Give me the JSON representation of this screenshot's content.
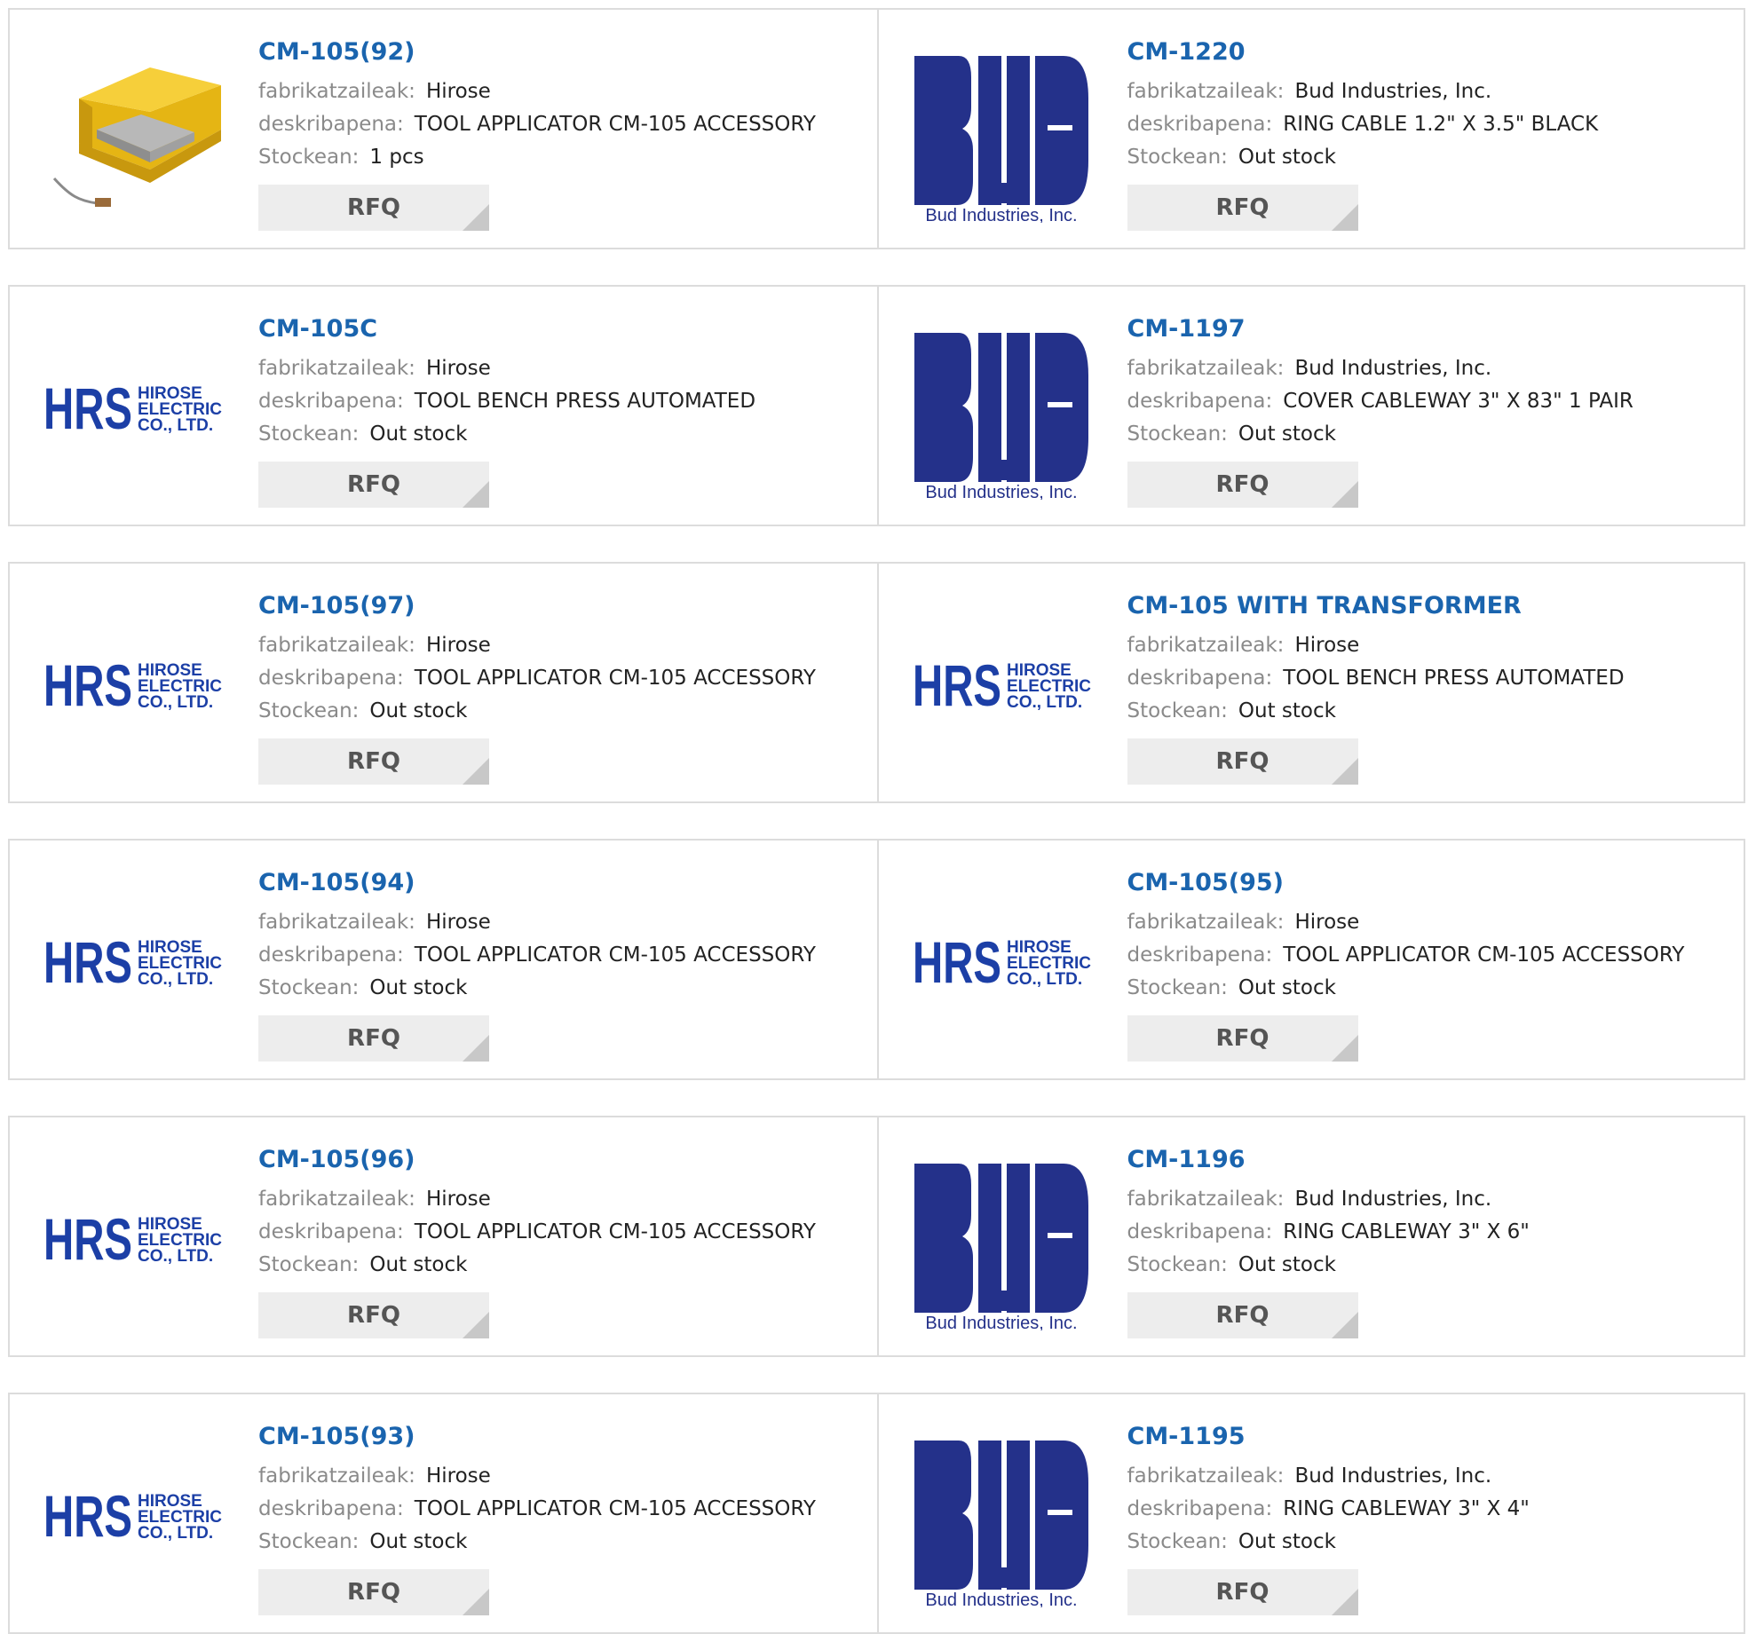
{
  "labels": {
    "manufacturer": "fabrikatzaileak:",
    "description": "deskribapena:",
    "stock": "Stockean:",
    "rfq": "RFQ"
  },
  "logos": {
    "hrs_mark": "HRS",
    "hrs_line1": "HIROSE",
    "hrs_line2": "ELECTRIC",
    "hrs_line3": "CO., LTD.",
    "bud_caption": "Bud Industries, Inc."
  },
  "colors": {
    "part_link": "#1a64ae",
    "label_gray": "#8a8a8a",
    "rfq_bg": "#ededed",
    "hrs_blue": "#1c3fa6",
    "bud_navy": "#24318a",
    "pedal_yellow": "#f2c21b"
  },
  "rows": [
    {
      "left": {
        "part": "CM-105(92)",
        "logo": "product-photo",
        "manufacturer": "Hirose",
        "description": "TOOL APPLICATOR CM-105 ACCESSORY",
        "stock": "1 pcs"
      },
      "right": {
        "part": "CM-1220",
        "logo": "bud-logo",
        "manufacturer": "Bud Industries, Inc.",
        "description": "RING CABLE 1.2\" X 3.5\" BLACK",
        "stock": "Out stock"
      }
    },
    {
      "left": {
        "part": "CM-105C",
        "logo": "hrs-logo",
        "manufacturer": "Hirose",
        "description": "TOOL BENCH PRESS AUTOMATED",
        "stock": "Out stock"
      },
      "right": {
        "part": "CM-1197",
        "logo": "bud-logo",
        "manufacturer": "Bud Industries, Inc.",
        "description": "COVER CABLEWAY 3\" X 83\" 1 PAIR",
        "stock": "Out stock"
      }
    },
    {
      "left": {
        "part": "CM-105(97)",
        "logo": "hrs-logo",
        "manufacturer": "Hirose",
        "description": "TOOL APPLICATOR CM-105 ACCESSORY",
        "stock": "Out stock"
      },
      "right": {
        "part": "CM-105 WITH TRANSFORMER",
        "logo": "hrs-logo",
        "manufacturer": "Hirose",
        "description": "TOOL BENCH PRESS AUTOMATED",
        "stock": "Out stock"
      }
    },
    {
      "left": {
        "part": "CM-105(94)",
        "logo": "hrs-logo",
        "manufacturer": "Hirose",
        "description": "TOOL APPLICATOR CM-105 ACCESSORY",
        "stock": "Out stock"
      },
      "right": {
        "part": "CM-105(95)",
        "logo": "hrs-logo",
        "manufacturer": "Hirose",
        "description": "TOOL APPLICATOR CM-105 ACCESSORY",
        "stock": "Out stock"
      }
    },
    {
      "left": {
        "part": "CM-105(96)",
        "logo": "hrs-logo",
        "manufacturer": "Hirose",
        "description": "TOOL APPLICATOR CM-105 ACCESSORY",
        "stock": "Out stock"
      },
      "right": {
        "part": "CM-1196",
        "logo": "bud-logo",
        "manufacturer": "Bud Industries, Inc.",
        "description": "RING CABLEWAY 3\" X 6\"",
        "stock": "Out stock"
      }
    },
    {
      "left": {
        "part": "CM-105(93)",
        "logo": "hrs-logo",
        "manufacturer": "Hirose",
        "description": "TOOL APPLICATOR CM-105 ACCESSORY",
        "stock": "Out stock"
      },
      "right": {
        "part": "CM-1195",
        "logo": "bud-logo",
        "manufacturer": "Bud Industries, Inc.",
        "description": "RING CABLEWAY 3\" X 4\"",
        "stock": "Out stock"
      }
    }
  ]
}
